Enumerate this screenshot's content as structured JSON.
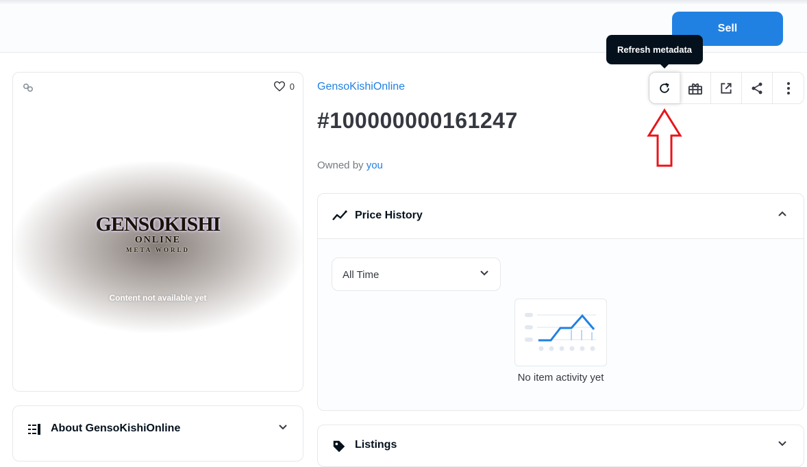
{
  "header": {
    "sell_label": "Sell"
  },
  "media": {
    "favorite_count": "0",
    "content_status": "Content not available yet",
    "logo": {
      "main": "GENSOKISHI",
      "sub": "ONLINE",
      "sub2": "META WORLD"
    }
  },
  "about": {
    "title": "About GensoKishiOnline"
  },
  "item": {
    "collection": "GensoKishiOnline",
    "token_id": "#100000000161247",
    "owned_by_prefix": "Owned by",
    "owner": "you"
  },
  "actions": {
    "tooltip": "Refresh metadata",
    "icons": [
      "refresh-icon",
      "gift-icon",
      "external-link-icon",
      "share-icon",
      "more-icon"
    ]
  },
  "price_history": {
    "title": "Price History",
    "time_filter": "All Time",
    "empty_text": "No item activity yet"
  },
  "listings": {
    "title": "Listings"
  },
  "colors": {
    "accent": "#2081e2",
    "dark": "#04111d",
    "annotation": "#e8141b"
  }
}
